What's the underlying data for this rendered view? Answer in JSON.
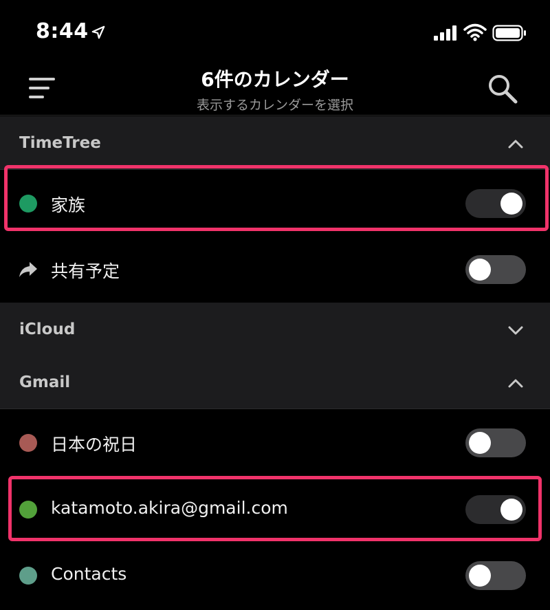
{
  "status": {
    "time": "8:44"
  },
  "header": {
    "title": "6件のカレンダー",
    "subtitle": "表示するカレンダーを選択"
  },
  "sections": [
    {
      "label": "TimeTree",
      "chevron": "chevron-up-icon",
      "rows": [
        {
          "label": "家族",
          "icon": "dot",
          "color": "#1e9a62",
          "enabled": true
        },
        {
          "label": "共有予定",
          "icon": "share-arrow-icon",
          "color": "#c8c8c8",
          "enabled": false
        }
      ]
    },
    {
      "label": "iCloud",
      "chevron": "chevron-down-icon",
      "rows": []
    },
    {
      "label": "Gmail",
      "chevron": "chevron-up-icon",
      "rows": [
        {
          "label": "日本の祝日",
          "icon": "dot",
          "color": "#a85a55",
          "enabled": false
        },
        {
          "label": "katamoto.akira@gmail.com",
          "icon": "dot",
          "color": "#52a13a",
          "enabled": true
        },
        {
          "label": "Contacts",
          "icon": "dot",
          "color": "#5e9e8a",
          "enabled": false
        }
      ]
    }
  ],
  "colors": {
    "highlight": "#f0336a",
    "background": "#000000",
    "section_background": "#1c1c1e"
  }
}
